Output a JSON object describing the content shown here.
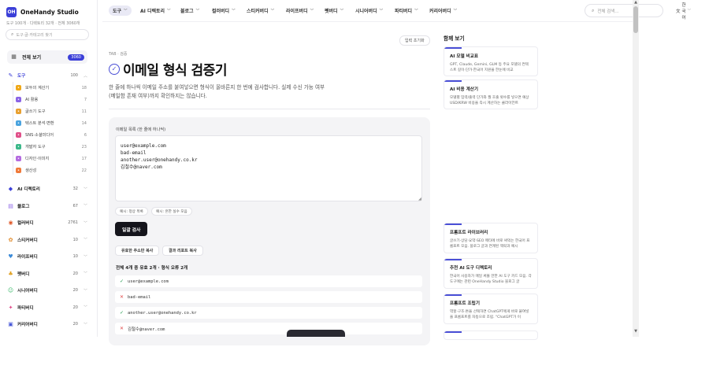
{
  "sidebar": {
    "brand_logo": "OH",
    "brand_name": "OneHandy Studio",
    "brand_sub": "도구 100개 · 디렉토리 32개 · 전체 3060개",
    "search_placeholder": "도구·글·카테고리 찾기",
    "view_all_label": "전체 보기",
    "view_all_count": "3060",
    "tools": {
      "label": "도구",
      "count": "100",
      "icon": "wrench-icon"
    },
    "subcategories": [
      {
        "label": "모두의 계산기",
        "count": "18",
        "color": "#f0a818",
        "icon": "calculator-icon"
      },
      {
        "label": "AI 활용",
        "count": "7",
        "color": "#8a63e6",
        "icon": "ai-icon"
      },
      {
        "label": "글쓰기 도구",
        "count": "11",
        "color": "#e8a030",
        "icon": "pen-icon"
      },
      {
        "label": "텍스트 분석·변환",
        "count": "14",
        "color": "#4aa3df",
        "icon": "text-icon"
      },
      {
        "label": "SNS·소셜미디어",
        "count": "6",
        "color": "#e0508a",
        "icon": "social-icon"
      },
      {
        "label": "개발자 도구",
        "count": "23",
        "color": "#3bb88a",
        "icon": "code-icon"
      },
      {
        "label": "디자인·이미지",
        "count": "17",
        "color": "#b46be0",
        "icon": "palette-icon"
      },
      {
        "label": "생산성",
        "count": "22",
        "color": "#f07a3a",
        "icon": "bolt-icon"
      }
    ],
    "categories": [
      {
        "label": "AI 디렉토리",
        "count": "32",
        "icon": "ai-directory-icon"
      },
      {
        "label": "블로그",
        "count": "67",
        "icon": "blog-icon"
      },
      {
        "label": "컬러버디",
        "count": "2761",
        "icon": "color-icon"
      },
      {
        "label": "스티커버디",
        "count": "10",
        "icon": "sticker-icon"
      },
      {
        "label": "라이프버디",
        "count": "10",
        "icon": "life-icon"
      },
      {
        "label": "펫버디",
        "count": "20",
        "icon": "pet-icon"
      },
      {
        "label": "시니어버디",
        "count": "20",
        "icon": "senior-icon"
      },
      {
        "label": "파티버디",
        "count": "20",
        "icon": "party-icon"
      },
      {
        "label": "커리어버디",
        "count": "20",
        "icon": "career-icon"
      }
    ]
  },
  "topnav": {
    "items": [
      "도구",
      "AI 디렉토리",
      "블로그",
      "컬러버디",
      "스티커버디",
      "라이프버디",
      "펫버디",
      "시니어버디",
      "파티버디",
      "커리어버디"
    ],
    "search_placeholder": "전체 검색...",
    "language": "한국어"
  },
  "main": {
    "reset_label": "입력 초기화",
    "breadcrumb": "TAB · 검증",
    "title": "이메일 형식 검증기",
    "description": "한 줄에 하나씩 이메일 주소를 붙여넣으면 형식이 올바른지 한 번에 검사합니다. 실제 수신 가능 여부(메일함 존재 여부)까지 확인하지는 않습니다.",
    "field_label": "이메일 목록 (한 줄에 하나씩)",
    "textarea_value": "user@example.com\nbad-email\nanother.user@onehandy.co.kr\n김철수@naver.com",
    "chips": [
      "예시: 정상 목록",
      "예시: 흔한 실수 모음"
    ],
    "check_button": "일괄 검사",
    "copy_valid_button": "유효한 주소만 복사",
    "copy_report_button": "결과 리포트 복사",
    "summary": "전체 4개 중 유효 2개 · 형식 오류 2개",
    "results": [
      {
        "status": "ok",
        "email": "user@example.com"
      },
      {
        "status": "bad",
        "email": "bad-email"
      },
      {
        "status": "ok",
        "email": "another.user@onehandy.co.kr"
      },
      {
        "status": "bad",
        "email": "김철수@naver.com"
      }
    ]
  },
  "right": {
    "title": "함께 보기",
    "cards_top": [
      {
        "title": "AI 모델 비교표",
        "desc": "GPT, Claude, Gemini, GLM 등 주요 모델의 컨텍스트 길이·단가·한국어 지원을 한눈에 비교"
      },
      {
        "title": "AI 비용 계산기",
        "desc": "모델별 입력/출력 단가와 월 호출 횟수를 넣으면 예상 USD/KRW 비용을 즉시 계산하는 클라이언트"
      }
    ],
    "cards_bottom": [
      {
        "title": "프롬프트 라이브러리",
        "desc": "글쓰기·상담·요약·SEO 메타에 바로 써먹는 한국어 프롬프트 모음. 블로그 글과 연계된 맥락과 예시"
      },
      {
        "title": "추천 AI 도구 디렉토리",
        "desc": "한국어 사용자가 매일 써볼 만한 AI 도구 카드 모음. 각 도구에는 관련 OneHandy Studio 블로그 글"
      },
      {
        "title": "프롬프트 조립기",
        "desc": "역할·구조·톤을 선택하면 ChatGPT에게 바로 붙여넣을 프롬프트를 자동으로 조립. \"ChatGPT가 이"
      }
    ]
  }
}
